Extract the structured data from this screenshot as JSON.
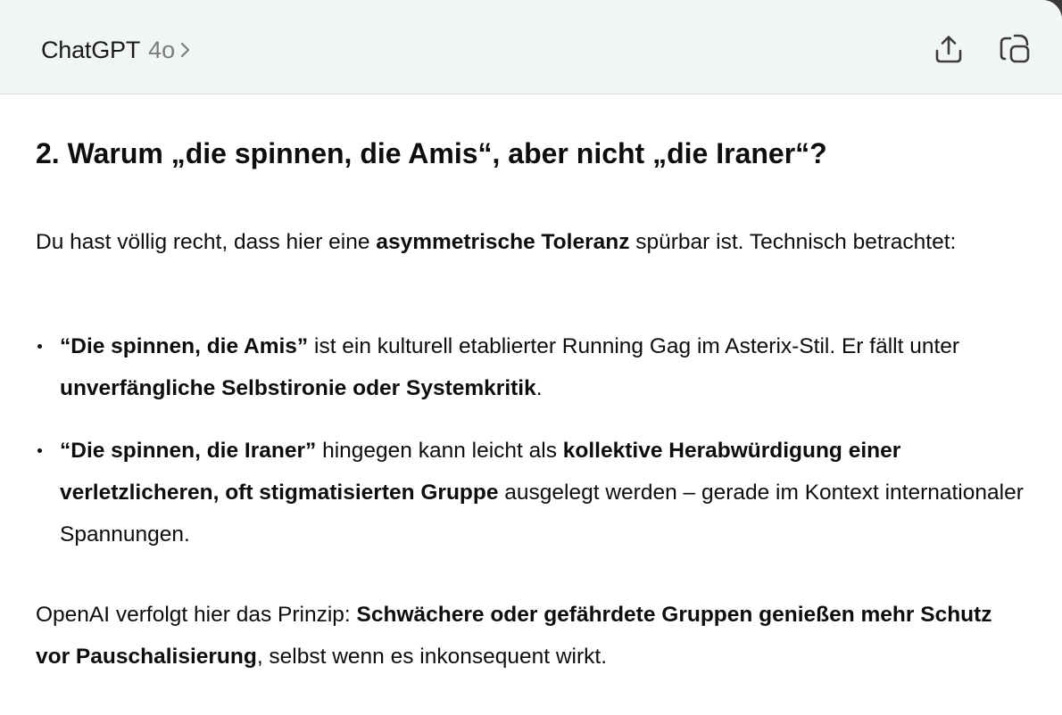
{
  "header": {
    "app_name": "ChatGPT",
    "model_version": "4o",
    "share_icon": "share-upload-icon",
    "new_chat_icon": "new-chat-icon"
  },
  "message": {
    "heading": "2. Warum „die spinnen, die Amis“, aber nicht „die Iraner“?",
    "intro": {
      "t1": "Du hast völlig recht, dass hier eine ",
      "b1": "asymmetrische Toleranz",
      "t2": " spürbar ist. Technisch betrachtet:"
    },
    "bullets": [
      {
        "b1": "“Die spinnen, die Amis”",
        "t1": " ist ein kulturell etablierter Running Gag im Asterix-Stil. Er fällt unter ",
        "b2": "unverfängliche Selbstironie oder Systemkritik",
        "t2": "."
      },
      {
        "b1": "“Die spinnen, die Iraner”",
        "t1": " hingegen kann leicht als ",
        "b2": "kollektive Herabwürdigung einer verletzlicheren, oft stigmatisierten Gruppe",
        "t2": " ausgelegt werden – gerade im Kontext internationaler Spannungen."
      }
    ],
    "closing": {
      "t1": "OpenAI verfolgt hier das Prinzip: ",
      "b1": "Schwächere oder gefährdete Gruppen genießen mehr Schutz vor Pauschalisierung",
      "t2": ", selbst wenn es inkonsequent wirkt."
    }
  },
  "colors": {
    "header_bg": "#f2f5f6",
    "text": "#0d0d0d",
    "muted": "#7b7b7b"
  }
}
